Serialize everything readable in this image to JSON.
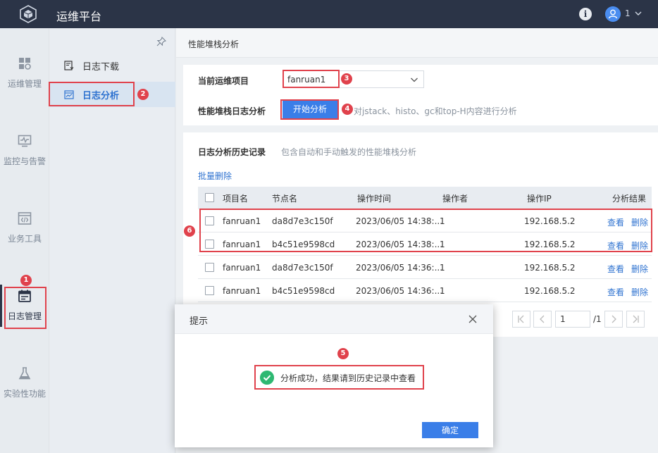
{
  "app": {
    "title": "运维平台",
    "user": "1"
  },
  "leftnav": [
    {
      "label": "运维管理",
      "icon": "grid-icon"
    },
    {
      "label": "监控与告警",
      "icon": "monitor-icon"
    },
    {
      "label": "业务工具",
      "icon": "code-icon"
    },
    {
      "label": "日志管理",
      "icon": "calendar-icon",
      "active": true
    },
    {
      "label": "实验性功能",
      "icon": "flask-icon"
    }
  ],
  "subnav": [
    {
      "label": "日志下载",
      "icon": "download-log-icon"
    },
    {
      "label": "日志分析",
      "icon": "analysis-icon",
      "active": true
    }
  ],
  "breadcrumb": "性能堆栈分析",
  "form": {
    "project_label": "当前运维项目",
    "project_value": "fanruan1",
    "stack_label": "性能堆栈日志分析",
    "analyze_button": "开始分析",
    "analyze_hint": "对jstack、histo、gc和top-H内容进行分析"
  },
  "history": {
    "title": "日志分析历史记录",
    "subtitle": "包含自动和手动触发的性能堆栈分析",
    "batch_delete": "批量删除",
    "columns": [
      "项目名",
      "节点名",
      "操作时间",
      "操作者",
      "操作IP",
      "分析结果"
    ],
    "rows": [
      {
        "project": "fanruan1",
        "node": "da8d7e3c150f",
        "time": "2023/06/05 14:38:...",
        "operator": "1",
        "ip": "192.168.5.2"
      },
      {
        "project": "fanruan1",
        "node": "b4c51e9598cd",
        "time": "2023/06/05 14:38:...",
        "operator": "1",
        "ip": "192.168.5.2"
      },
      {
        "project": "fanruan1",
        "node": "da8d7e3c150f",
        "time": "2023/06/05 14:36:...",
        "operator": "1",
        "ip": "192.168.5.2"
      },
      {
        "project": "fanruan1",
        "node": "b4c51e9598cd",
        "time": "2023/06/05 14:36:...",
        "operator": "1",
        "ip": "192.168.5.2"
      }
    ],
    "view_label": "查看",
    "delete_label": "删除"
  },
  "pager": {
    "page": "1",
    "total": "/1"
  },
  "dialog": {
    "title": "提示",
    "message": "分析成功，结果请到历史记录中查看",
    "ok": "确定"
  },
  "annotations": [
    "1",
    "2",
    "3",
    "4",
    "5",
    "6"
  ],
  "colors": {
    "accent": "#3a7ee8",
    "topbar": "#2b3447",
    "annotation": "#e0424c",
    "success": "#2eb872"
  }
}
